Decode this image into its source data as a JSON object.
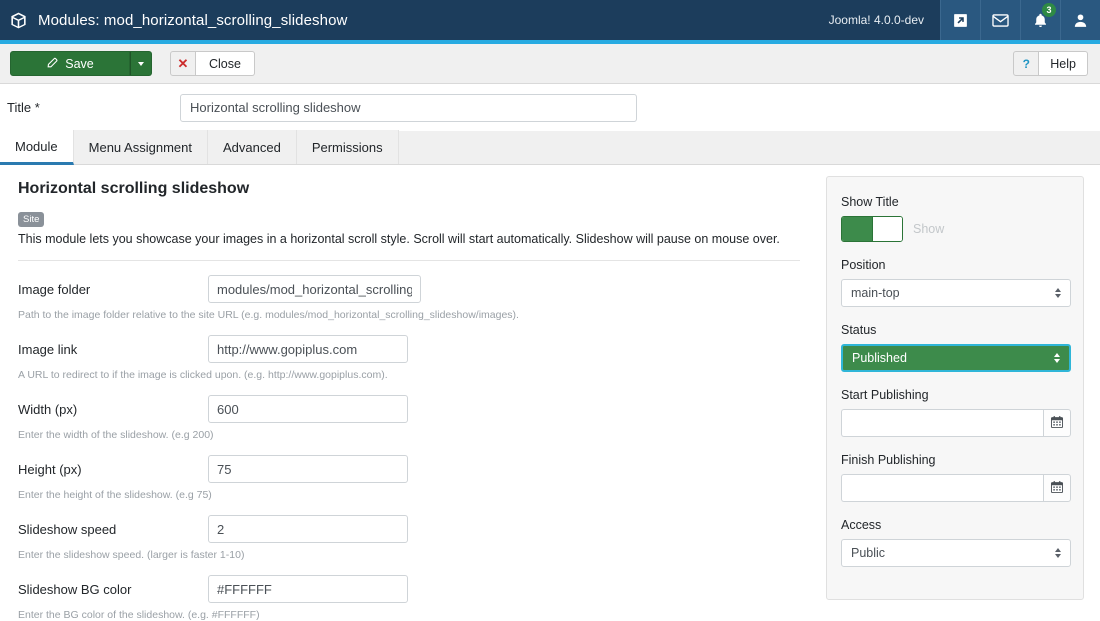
{
  "header": {
    "icon": "cube-icon",
    "title": "Modules: mod_horizontal_scrolling_slideshow",
    "version": "Joomla! 4.0.0-dev",
    "actions": [
      {
        "icon": "external-link-icon",
        "name": "preview-site"
      },
      {
        "icon": "envelope-icon",
        "name": "messages"
      },
      {
        "icon": "bell-icon",
        "name": "notifications",
        "badge": "3"
      },
      {
        "icon": "user-icon",
        "name": "user-menu"
      }
    ]
  },
  "toolbar": {
    "save_label": "Save",
    "save_icon": "edit-pencil-icon",
    "save_dropdown_icon": "chevron-down-icon",
    "close_icon": "close-x-icon",
    "close_label": "Close",
    "help_icon": "question-mark-icon",
    "help_label": "Help"
  },
  "title_field": {
    "label": "Title *",
    "value": "Horizontal scrolling slideshow",
    "placeholder": ""
  },
  "tabs": [
    {
      "label": "Module",
      "active": true
    },
    {
      "label": "Menu Assignment",
      "active": false
    },
    {
      "label": "Advanced",
      "active": false
    },
    {
      "label": "Permissions",
      "active": false
    }
  ],
  "module": {
    "heading": "Horizontal scrolling slideshow",
    "badge": "Site",
    "description": "This module lets you showcase your images in a horizontal scroll style. Scroll will start automatically. Slideshow will pause on mouse over."
  },
  "fields": [
    {
      "label": "Image folder",
      "value": "modules/mod_horizontal_scrolling_",
      "help": "Path to the image folder relative to the site URL (e.g. modules/mod_horizontal_scrolling_slideshow/images)."
    },
    {
      "label": "Image link",
      "value": "http://www.gopiplus.com",
      "help": "A URL to redirect to if the image is clicked upon. (e.g. http://www.gopiplus.com)."
    },
    {
      "label": "Width (px)",
      "value": "600",
      "help": "Enter the width of the slideshow. (e.g 200)"
    },
    {
      "label": "Height (px)",
      "value": "75",
      "help": "Enter the height of the slideshow. (e.g 75)"
    },
    {
      "label": "Slideshow speed",
      "value": "2",
      "help": "Enter the slideshow speed. (larger is faster 1-10)"
    },
    {
      "label": "Slideshow BG color",
      "value": "#FFFFFF",
      "help": "Enter the BG color of the slideshow. (e.g. #FFFFFF)"
    }
  ],
  "sidebar": {
    "show_title": {
      "label": "Show Title",
      "toggle_state": "on",
      "toggle_text": "Show"
    },
    "position": {
      "label": "Position",
      "value": "main-top"
    },
    "status": {
      "label": "Status",
      "value": "Published"
    },
    "start_publishing": {
      "label": "Start Publishing",
      "value": "",
      "calendar_icon": "calendar-icon"
    },
    "finish_publishing": {
      "label": "Finish Publishing",
      "value": "",
      "calendar_icon": "calendar-icon"
    },
    "access": {
      "label": "Access",
      "value": "Public"
    }
  },
  "colors": {
    "header_bg": "#1c3d5c",
    "accent": "#27aae1",
    "success": "#3d8b4b",
    "save_green": "#2b7437",
    "tab_active_underline": "#2a7ab0",
    "danger": "#cc2b2b"
  }
}
